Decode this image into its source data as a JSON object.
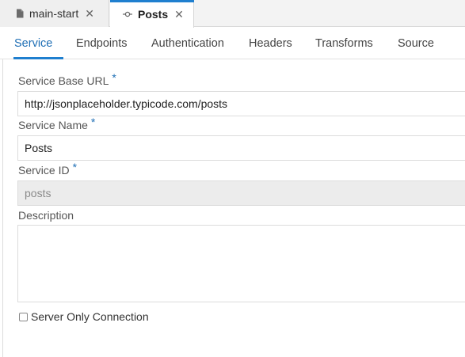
{
  "editor_tabs": [
    {
      "label": "main-start",
      "icon": "file-icon",
      "close": "✕"
    },
    {
      "label": "Posts",
      "icon": "service-icon",
      "close": "✕",
      "active": true
    }
  ],
  "subtabs": [
    {
      "label": "Service",
      "active": true
    },
    {
      "label": "Endpoints"
    },
    {
      "label": "Authentication"
    },
    {
      "label": "Headers"
    },
    {
      "label": "Transforms"
    },
    {
      "label": "Source"
    }
  ],
  "form": {
    "base_url": {
      "label": "Service Base URL",
      "required": "*",
      "value": "http://jsonplaceholder.typicode.com/posts"
    },
    "name": {
      "label": "Service Name",
      "required": "*",
      "value": "Posts"
    },
    "id": {
      "label": "Service ID",
      "required": "*",
      "value": "posts"
    },
    "description": {
      "label": "Description",
      "value": ""
    },
    "server_only": {
      "label": "Server Only Connection",
      "checked": false
    }
  },
  "colors": {
    "accent": "#1f7fcf",
    "active_text": "#1f6fb5",
    "disabled_bg": "#ececec"
  }
}
